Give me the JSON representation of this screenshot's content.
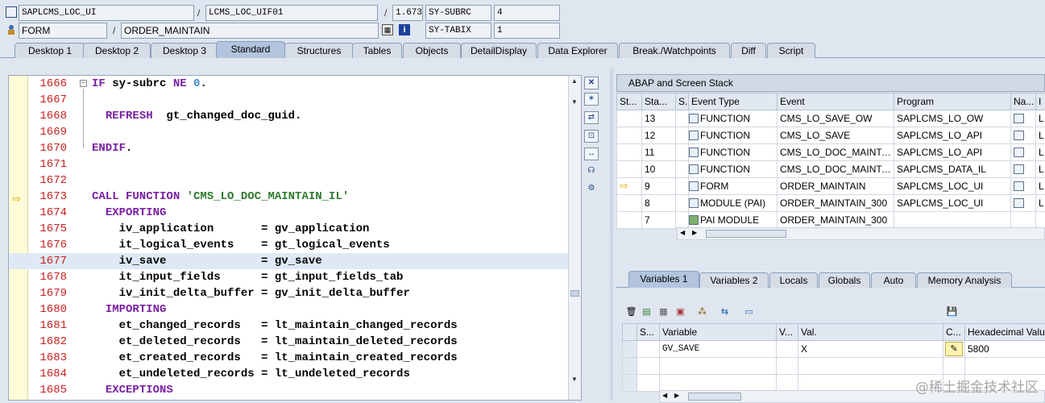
{
  "header": {
    "program": "SAPLCMS_LOC_UI",
    "include": "LCMS_LOC_UIF01",
    "line": "1.673",
    "subrc_label": "SY-SUBRC",
    "subrc_value": "4",
    "kind": "FORM",
    "routine": "ORDER_MAINTAIN",
    "tabix_label": "SY-TABIX",
    "tabix_value": "1"
  },
  "tabs": [
    "Desktop 1",
    "Desktop 2",
    "Desktop 3",
    "Standard",
    "Structures",
    "Tables",
    "Objects",
    "DetailDisplay",
    "Data Explorer",
    "Break./Watchpoints",
    "Diff",
    "Script"
  ],
  "active_tab": "Standard",
  "editor": {
    "lines": [
      {
        "n": "1666",
        "code": [
          [
            "kw",
            "IF"
          ],
          [
            "t",
            " sy-subrc "
          ],
          [
            "kw",
            "NE"
          ],
          [
            "t",
            " "
          ],
          [
            "num",
            "0"
          ],
          [
            "t",
            "."
          ]
        ]
      },
      {
        "n": "1667",
        "code": []
      },
      {
        "n": "1668",
        "code": [
          [
            "t",
            "  "
          ],
          [
            "kw",
            "REFRESH"
          ],
          [
            "t",
            "  gt_changed_doc_guid."
          ]
        ]
      },
      {
        "n": "1669",
        "code": []
      },
      {
        "n": "1670",
        "code": [
          [
            "kw",
            "ENDIF"
          ],
          [
            "t",
            "."
          ]
        ]
      },
      {
        "n": "1671",
        "code": []
      },
      {
        "n": "1672",
        "code": []
      },
      {
        "n": "1673",
        "code": [
          [
            "kw",
            "CALL FUNCTION"
          ],
          [
            "t",
            " "
          ],
          [
            "str",
            "'CMS_LO_DOC_MAINTAIN_IL'"
          ]
        ]
      },
      {
        "n": "1674",
        "code": [
          [
            "t",
            "  "
          ],
          [
            "kw",
            "EXPORTING"
          ]
        ]
      },
      {
        "n": "1675",
        "code": [
          [
            "t",
            "    iv_application       = gv_application"
          ]
        ]
      },
      {
        "n": "1676",
        "code": [
          [
            "t",
            "    it_logical_events    = gt_logical_events"
          ]
        ]
      },
      {
        "n": "1677",
        "code": [
          [
            "t",
            "    iv_save              = gv_save"
          ]
        ]
      },
      {
        "n": "1678",
        "code": [
          [
            "t",
            "    it_input_fields      = gt_input_fields_tab"
          ]
        ]
      },
      {
        "n": "1679",
        "code": [
          [
            "t",
            "    iv_init_delta_buffer = gv_init_delta_buffer"
          ]
        ]
      },
      {
        "n": "1680",
        "code": [
          [
            "t",
            "  "
          ],
          [
            "kw",
            "IMPORTING"
          ]
        ]
      },
      {
        "n": "1681",
        "code": [
          [
            "t",
            "    et_changed_records   = lt_maintain_changed_records"
          ]
        ]
      },
      {
        "n": "1682",
        "code": [
          [
            "t",
            "    et_deleted_records   = lt_maintain_deleted_records"
          ]
        ]
      },
      {
        "n": "1683",
        "code": [
          [
            "t",
            "    et_created_records   = lt_maintain_created_records"
          ]
        ]
      },
      {
        "n": "1684",
        "code": [
          [
            "t",
            "    et_undeleted_records = lt_undeleted_records"
          ]
        ]
      },
      {
        "n": "1685",
        "code": [
          [
            "t",
            "  "
          ],
          [
            "kw",
            "EXCEPTIONS"
          ]
        ]
      }
    ]
  },
  "stack": {
    "title": "ABAP and Screen Stack",
    "columns": [
      "St...",
      "Sta...",
      "S...",
      "Event Type",
      "Event",
      "Program",
      "Na...",
      "I"
    ],
    "rows": [
      {
        "level": "13",
        "type": "FUNCTION",
        "event": "CMS_LO_SAVE_OW",
        "program": "SAPLCMS_LO_OW",
        "inc": "L"
      },
      {
        "level": "12",
        "type": "FUNCTION",
        "event": "CMS_LO_SAVE",
        "program": "SAPLCMS_LO_API",
        "inc": "L"
      },
      {
        "level": "11",
        "type": "FUNCTION",
        "event": "CMS_LO_DOC_MAINTAIN",
        "program": "SAPLCMS_LO_API",
        "inc": "L"
      },
      {
        "level": "10",
        "type": "FUNCTION",
        "event": "CMS_LO_DOC_MAINTAI...",
        "program": "SAPLCMS_DATA_IL",
        "inc": "L"
      },
      {
        "level": "9",
        "type": "FORM",
        "event": "ORDER_MAINTAIN",
        "program": "SAPLCMS_LOC_UI",
        "inc": "L"
      },
      {
        "level": "8",
        "type": "MODULE (PAI)",
        "event": "ORDER_MAINTAIN_300",
        "program": "SAPLCMS_LOC_UI",
        "inc": "L"
      },
      {
        "level": "7",
        "type": "PAI MODULE",
        "event": "ORDER_MAINTAIN_300",
        "program": "",
        "inc": ""
      }
    ]
  },
  "var_tabs": [
    "Variables 1",
    "Variables 2",
    "Locals",
    "Globals",
    "Auto",
    "Memory Analysis"
  ],
  "variables": {
    "columns": [
      "S...",
      "Variable",
      "V...",
      "Val.",
      "C...",
      "Hexadecimal Value"
    ],
    "rows": [
      {
        "name": "GV_SAVE",
        "value": "X",
        "hex": "5800"
      }
    ]
  },
  "watermark": "@稀土掘金技术社区"
}
